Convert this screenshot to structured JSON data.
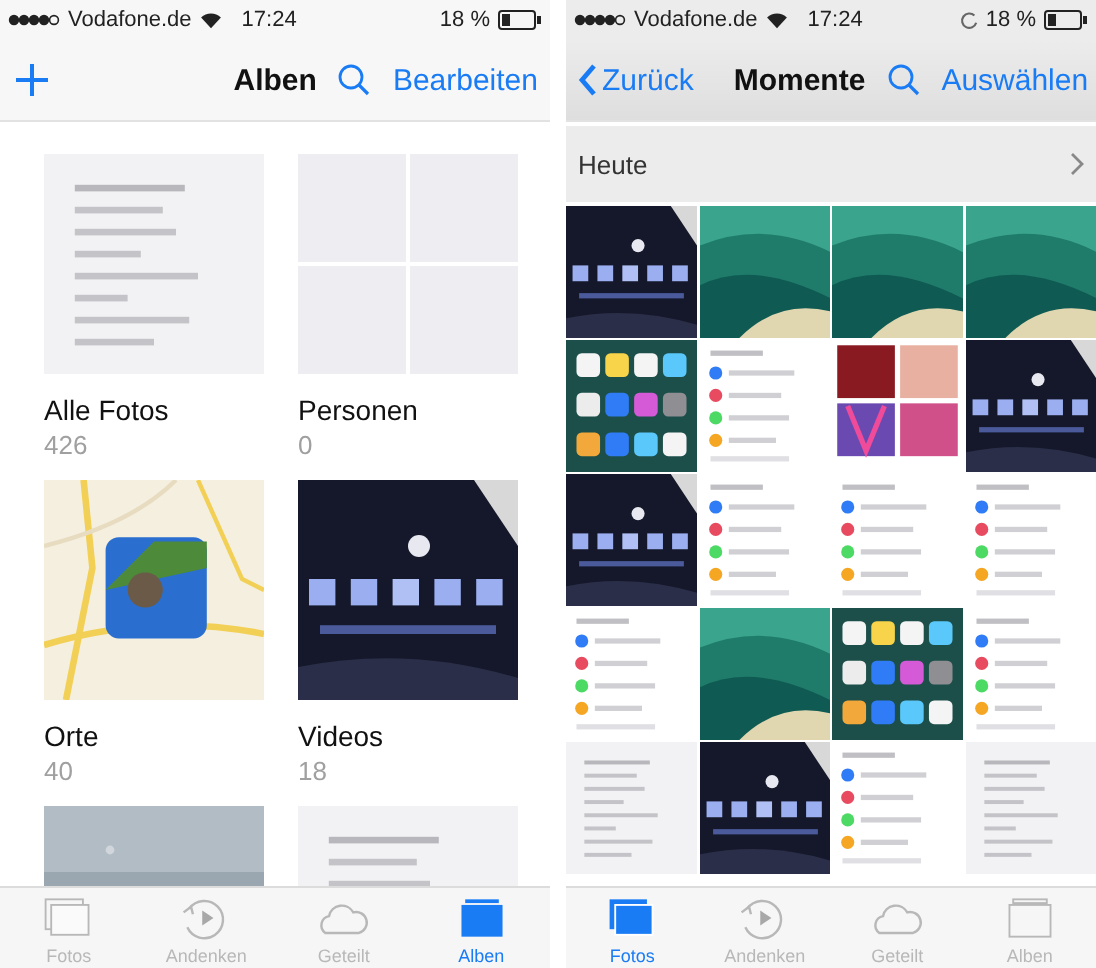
{
  "phones": [
    {
      "status": {
        "carrier": "Vodafone.de",
        "time": "17:24",
        "battery": "18 %",
        "rotation_lock": false
      },
      "nav": {
        "left": {
          "kind": "add"
        },
        "title": "Alben",
        "action": "Bearbeiten"
      },
      "content": {
        "kind": "albums",
        "albums": [
          {
            "title": "Alle Fotos",
            "count": "426",
            "kind": "picture"
          },
          {
            "title": "Personen",
            "count": "0",
            "kind": "empty"
          },
          {
            "title": "Orte",
            "count": "40",
            "kind": "picture"
          },
          {
            "title": "Videos",
            "count": "18",
            "kind": "picture"
          },
          {
            "kind": "picture"
          },
          {
            "kind": "picture"
          }
        ]
      },
      "tabs": [
        {
          "label": "Fotos",
          "selected": false
        },
        {
          "label": "Andenken",
          "selected": false
        },
        {
          "label": "Geteilt",
          "selected": false
        },
        {
          "label": "Alben",
          "selected": true
        }
      ]
    },
    {
      "status": {
        "carrier": "Vodafone.de",
        "time": "17:24",
        "battery": "18 %",
        "rotation_lock": true
      },
      "nav": {
        "left": {
          "kind": "back",
          "label": "Zurück"
        },
        "title": "Momente",
        "action": "Auswählen"
      },
      "content": {
        "kind": "moments",
        "section": "Heute",
        "tiles": [
          {
            "kind": "picture"
          },
          {
            "kind": "picture"
          },
          {
            "kind": "picture"
          },
          {
            "kind": "picture"
          },
          {
            "kind": "picture"
          },
          {
            "kind": "picture"
          },
          {
            "kind": "picture"
          },
          {
            "kind": "picture"
          },
          {
            "kind": "picture"
          },
          {
            "kind": "picture"
          },
          {
            "kind": "picture"
          },
          {
            "kind": "picture"
          },
          {
            "kind": "picture"
          },
          {
            "kind": "picture"
          },
          {
            "kind": "picture"
          },
          {
            "kind": "picture"
          },
          {
            "kind": "picture"
          },
          {
            "kind": "picture"
          },
          {
            "kind": "picture"
          },
          {
            "kind": "picture"
          }
        ]
      },
      "tabs": [
        {
          "label": "Fotos",
          "selected": true
        },
        {
          "label": "Andenken",
          "selected": false
        },
        {
          "label": "Geteilt",
          "selected": false
        },
        {
          "label": "Alben",
          "selected": false
        }
      ]
    }
  ]
}
